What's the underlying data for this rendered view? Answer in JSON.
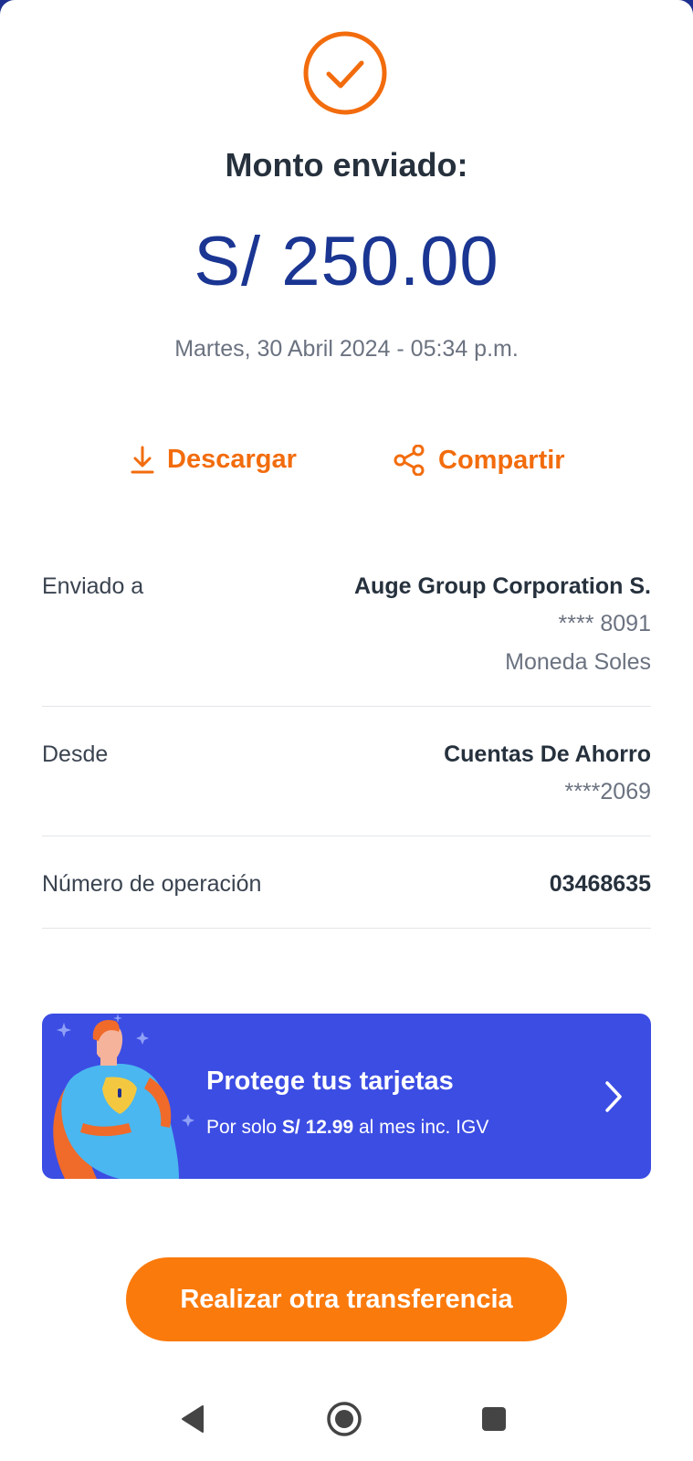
{
  "colors": {
    "accent_orange": "#f26c0d",
    "amount_blue": "#1a3592",
    "promo_blue": "#3c4de3",
    "cta_orange": "#fb7a0c"
  },
  "icons": {
    "status": "check-circle-icon",
    "download": "download-icon",
    "share": "share-icon",
    "promo_arrow": "chevron-right-icon"
  },
  "header": {
    "title": "Monto enviado:",
    "amount": "S/ 250.00",
    "datetime": "Martes, 30 Abril 2024 - 05:34 p.m."
  },
  "actions": {
    "download_label": "Descargar",
    "share_label": "Compartir"
  },
  "details": {
    "recipient": {
      "label": "Enviado a",
      "name": "Auge Group Corporation S.",
      "account": "**** 8091",
      "currency": "Moneda Soles"
    },
    "source": {
      "label": "Desde",
      "name": "Cuentas De Ahorro",
      "account": "****2069"
    },
    "operation": {
      "label": "Número de operación",
      "number": "03468635"
    }
  },
  "promo": {
    "title": "Protege tus tarjetas",
    "subtitle_prefix": "Por solo",
    "price": "S/ 12.99",
    "subtitle_suffix": "al mes inc. IGV"
  },
  "cta": {
    "label": "Realizar otra transferencia"
  },
  "navbar": {
    "back_icon": "back-triangle-icon",
    "home_icon": "home-circle-icon",
    "recent_icon": "recent-square-icon"
  }
}
